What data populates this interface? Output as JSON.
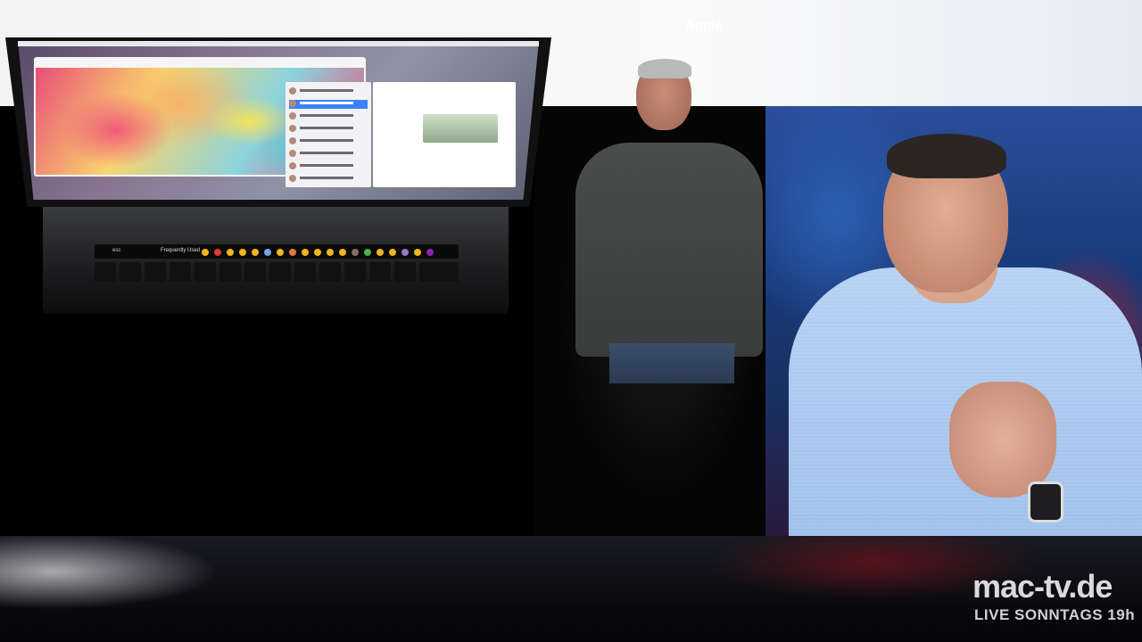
{
  "keynote": {
    "corner_label": "Apple",
    "touch_bar": {
      "esc_label": "esc",
      "frequently_used_label": "Frequently Used"
    }
  },
  "watermark": {
    "brand": "mac-tv.de",
    "tagline": "LIVE SONNTAGS 19h"
  },
  "colors": {
    "background": "#000000",
    "host_backdrop_blue": "#2a4e9a",
    "host_shirt": "#b5d1f4",
    "watermark_text": "#d9d9de"
  }
}
